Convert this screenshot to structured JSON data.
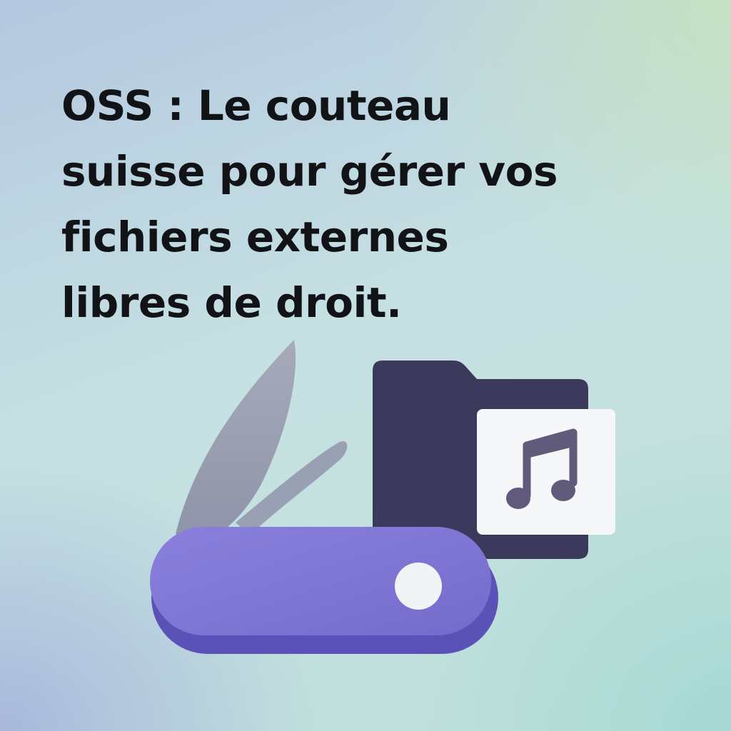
{
  "headline": {
    "lines": [
      "OSS : Le couteau",
      "suisse pour gérer vos",
      "fichiers externes",
      "libres de droit."
    ]
  },
  "illustration": {
    "icons": [
      "swiss-knife-icon",
      "folder-icon",
      "music-note-icon"
    ],
    "colors": {
      "text": "#111316",
      "knife_handle": "#8277d4",
      "knife_handle_shadow": "#5b52b8",
      "knife_blade": "#9da3b8",
      "folder": "#3c3a5c",
      "card": "#f6f7f8",
      "music_note": "#615a7a"
    }
  }
}
